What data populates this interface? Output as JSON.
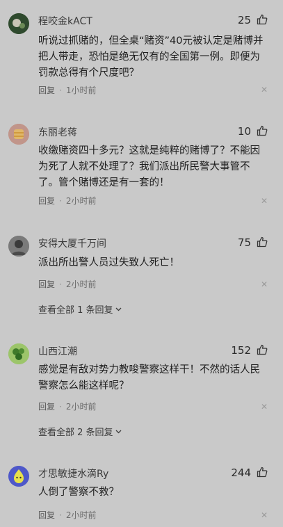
{
  "comments": [
    {
      "user": "程咬金kACT",
      "likes": "25",
      "text": "听说过抓赌的，但全桌“赌资”40元被认定是赌博并把人带走，恐怕是绝无仅有的全国第一例。即便为罚款总得有个尺度吧？",
      "reply_label": "回复",
      "time": "1小时前",
      "view_all": ""
    },
    {
      "user": "东丽老蒋",
      "likes": "10",
      "text": "收缴赌资四十多元？这就是纯粹的赌博了？不能因为死了人就不处理了？我们派出所民警大事管不了。管个赌博还是有一套的！",
      "reply_label": "回复",
      "time": "2小时前",
      "view_all": ""
    },
    {
      "user": "安得大厦千万间",
      "likes": "75",
      "text": "派出所出警人员过失致人死亡！",
      "reply_label": "回复",
      "time": "2小时前",
      "view_all": "查看全部 1 条回复"
    },
    {
      "user": "山西江潮",
      "likes": "152",
      "text": "感觉是有敌对势力教唆警察这样干！不然的话人民警察怎么能这样呢？",
      "reply_label": "回复",
      "time": "2小时前",
      "view_all": "查看全部 2 条回复"
    },
    {
      "user": "才思敏捷水滴Ry",
      "likes": "244",
      "text": "人倒了警察不救？",
      "reply_label": "回复",
      "time": "2小时前",
      "view_all": ""
    }
  ],
  "icons": {
    "like": "thumbs-up-icon",
    "close": "close-icon",
    "chevron": "chevron-down-icon"
  }
}
